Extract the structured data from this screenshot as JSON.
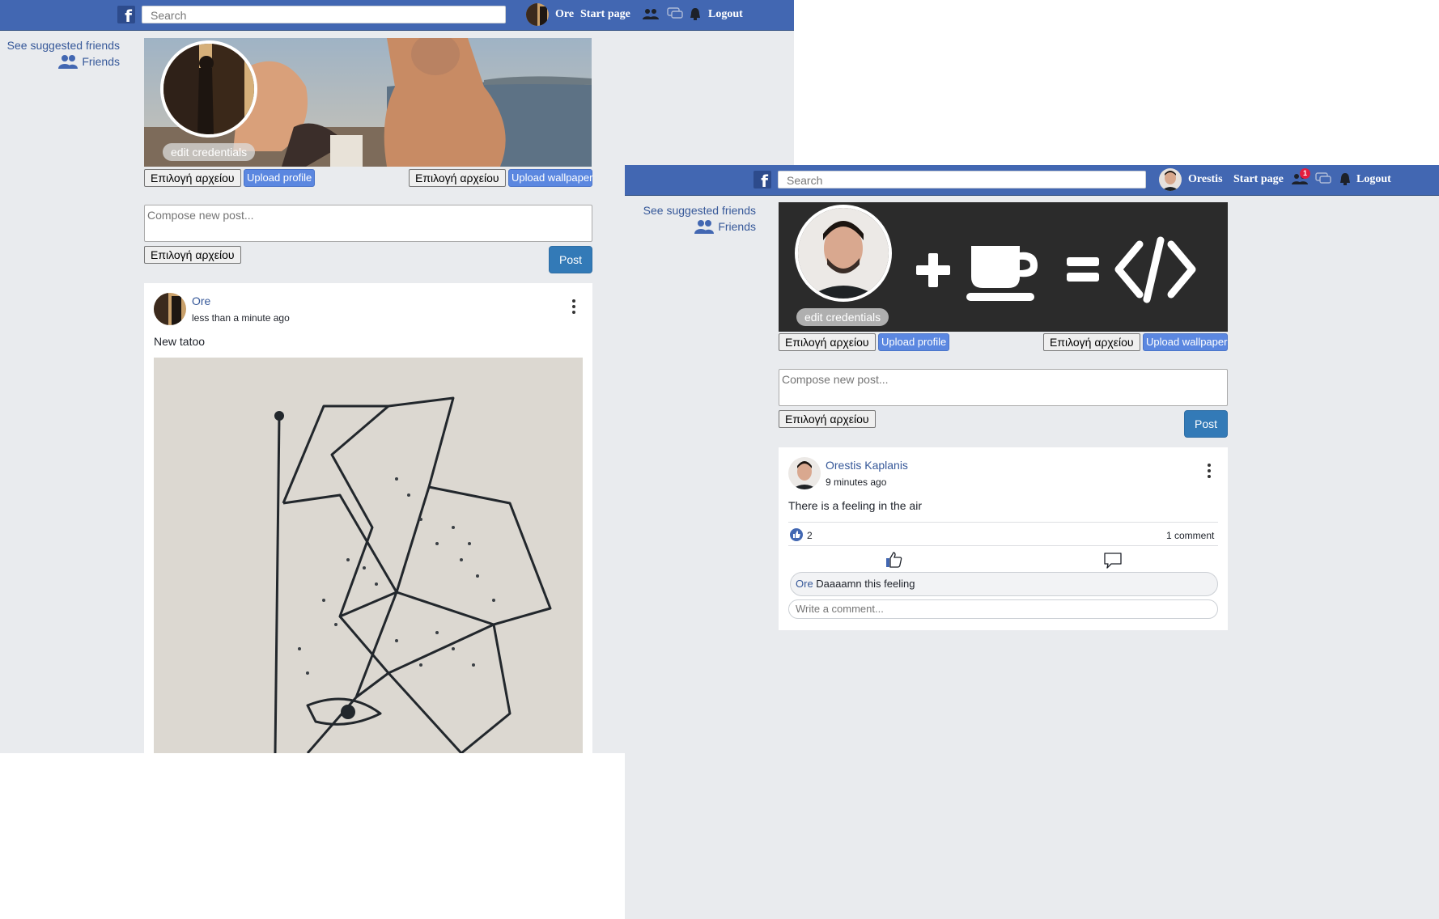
{
  "screen_a": {
    "nav": {
      "logo": "f",
      "search_placeholder": "Search",
      "user_name": "Ore",
      "start_page": "Start page",
      "logout": "Logout"
    },
    "sidebar": {
      "suggested": "See suggested friends",
      "friends": "Friends"
    },
    "profile": {
      "edit_credentials": "edit credentials",
      "choose_file_profile": "Επιλογή αρχείου",
      "upload_profile": "Upload profile",
      "choose_file_wallpaper": "Επιλογή αρχείου",
      "upload_wallpaper": "Upload wallpaper"
    },
    "composer": {
      "placeholder": "Compose new post...",
      "choose_file": "Επιλογή αρχείου",
      "post": "Post"
    },
    "post": {
      "author": "Ore",
      "time": "less than a minute ago",
      "text": "New tatoo"
    }
  },
  "screen_b": {
    "nav": {
      "logo": "f",
      "search_placeholder": "Search",
      "user_name": "Orestis",
      "start_page": "Start page",
      "friend_requests_badge": "1",
      "logout": "Logout"
    },
    "sidebar": {
      "suggested": "See suggested friends",
      "friends": "Friends"
    },
    "profile": {
      "edit_credentials": "edit credentials",
      "choose_file_profile": "Επιλογή αρχείου",
      "upload_profile": "Upload profile",
      "choose_file_wallpaper": "Επιλογή αρχείου",
      "upload_wallpaper": "Upload wallpaper"
    },
    "composer": {
      "placeholder": "Compose new post...",
      "choose_file": "Επιλογή αρχείου",
      "post": "Post"
    },
    "post": {
      "author": "Orestis Kaplanis",
      "time": "9 minutes ago",
      "text": "There is a feeling in the air",
      "likes": "2",
      "comments_count": "1 comment",
      "comment": {
        "author": "Ore",
        "text": "Daaaamn this feeling"
      },
      "write_comment_placeholder": "Write a comment..."
    }
  },
  "colors": {
    "topbar": "#4267b2",
    "page_bg": "#e9ebee",
    "link": "#365899",
    "upload_button": "#5b87e0",
    "post_button": "#337ab7",
    "badge": "#e41e3f"
  }
}
